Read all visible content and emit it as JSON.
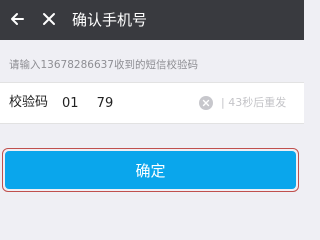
{
  "header": {
    "title": "确认手机号",
    "back_icon": "arrow-left-icon",
    "close_icon": "close-icon",
    "background_color": "#393a3f"
  },
  "hint": {
    "text": "请输入13678286637收到的短信校验码"
  },
  "verification": {
    "label": "校验码",
    "value": "01 79",
    "clear_icon": "clear-circle-icon",
    "resend_text": "| 43秒后重发"
  },
  "confirm": {
    "label": "确定",
    "color": "#0aa6ec"
  }
}
